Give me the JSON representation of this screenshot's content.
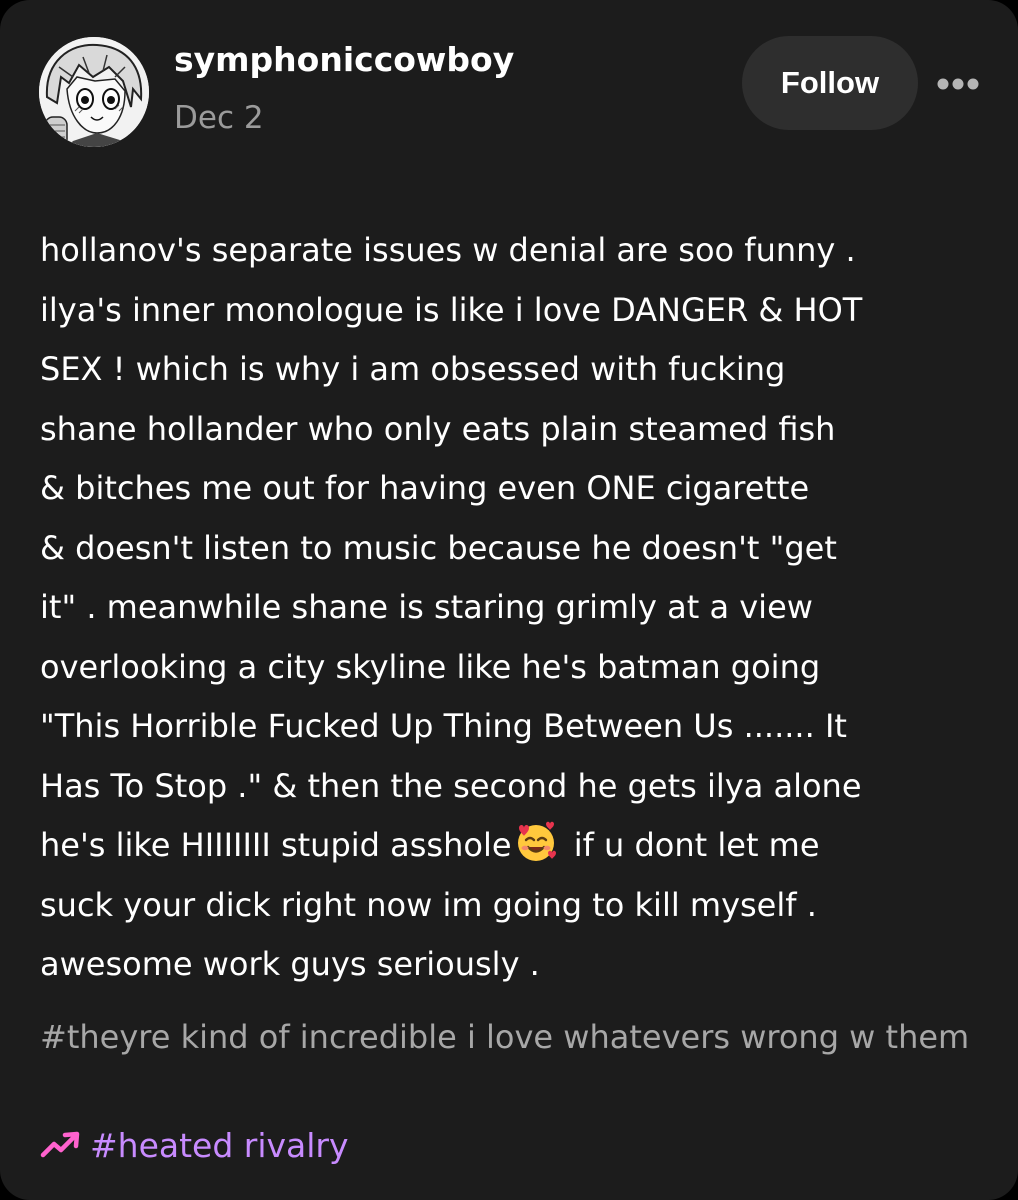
{
  "post": {
    "author": "symphoniccowboy",
    "date": "Dec 2",
    "follow_label": "Follow",
    "more_icon": "more-dots-icon",
    "text_segments": {
      "before_emoji": "hollanov's separate issues w denial are soo funny .\nilya's inner monologue is like i love DANGER & HOT\nSEX ! which is why i am obsessed with fucking\nshane hollander who only eats plain steamed fish\n& bitches me out for having even ONE cigarette\n& doesn't listen to music because he doesn't \"get\nit\" . meanwhile shane is staring grimly at a view\noverlooking a city skyline like he's batman going\n\"This Horrible Fucked Up Thing Between Us ....... It\nHas To Stop .\" & then the second he gets ilya alone\nhe's like HIIIIIII stupid asshole",
      "emoji": "smiling-face-with-hearts-emoji",
      "after_emoji": " if u dont let me\nsuck your dick right now im going to kill myself .\nawesome work guys seriously ."
    },
    "tags": [
      "#theyre kind of incredible i love whatevers wrong w them"
    ],
    "trending_tag": "#heated rivalry",
    "trending_icon": "trending-arrow-icon",
    "colors": {
      "card_background": "#1c1c1c",
      "page_background": "#000000",
      "text_primary": "#ffffff",
      "text_secondary": "#9b9b9b",
      "follow_button_bg": "#2e2e2e",
      "trending_tag_color": "#c88bff",
      "trending_icon_color": "#ff62ce"
    }
  }
}
